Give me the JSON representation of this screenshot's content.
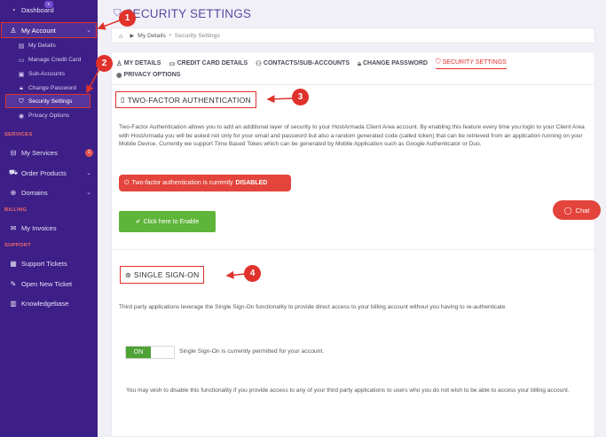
{
  "sidebar": {
    "dashboard": "Dashboard",
    "dashboard_badge": "",
    "my_account": "My Account",
    "sub_items": [
      "My Details",
      "Manage Credit Card",
      "Sub-Accounts",
      "Change Password",
      "Security Settings",
      "Privacy Options"
    ],
    "services_section": "SERVICES",
    "my_services": "My Services",
    "my_services_badge": "1",
    "order_products": "Order Products",
    "domains": "Domains",
    "billing_section": "BILLING",
    "my_invoices": "My Invoices",
    "support_section": "SUPPORT",
    "support_tickets": "Support Tickets",
    "open_new_ticket": "Open New Ticket",
    "knowledgebase": "Knowledgebase"
  },
  "page": {
    "title": "SECURITY SETTINGS"
  },
  "breadcrumb": {
    "items": [
      "My Details",
      "Security Settings"
    ]
  },
  "tabs": [
    "MY DETAILS",
    "CREDIT CARD DETAILS",
    "CONTACTS/SUB-ACCOUNTS",
    "CHANGE PASSWORD",
    "SECURITY SETTINGS",
    "PRIVACY OPTIONS"
  ],
  "two_factor": {
    "header": "TWO-FACTOR AUTHENTICATION",
    "description": "Two-Factor Authentication allows you to add an additional layer of security to your HostArmada Client Area account. By enabling this feature every time you login to your Client Area with HostArmada you will be asked not only for your email and password but also a random generated code (called token) that can be retrieved from an application running on your Mobile Device. Currently we support Time Based Tokes which can be generated by Mobile Application such as Google Authenticator or Duo.",
    "status_prefix": "Two-factor authentication is currently",
    "status_value": "DISABLED",
    "enable_button": "Click here to Enable"
  },
  "sso": {
    "header": "SINGLE SIGN-ON",
    "description": "Third party applications leverage the Single Sign-On functionality to provide direct access to your billing account without you having to re-authenticate.",
    "toggle_label": "ON",
    "toggle_status": "Single Sign-On is currently permitted for your account.",
    "disable_note": "You may wish to disable this functionality if you provide access to any of your third party applications to users who you do not wish to be able to access your billing account."
  },
  "callouts": [
    "1",
    "2",
    "3",
    "4"
  ],
  "chat": {
    "label": "Chat"
  },
  "colors": {
    "sidebar_bg": "#3d1f87",
    "accent_red": "#e0312b",
    "enable_green": "#5fb53a",
    "toggle_green": "#4ea236",
    "title_purple": "#5a4aa3"
  }
}
